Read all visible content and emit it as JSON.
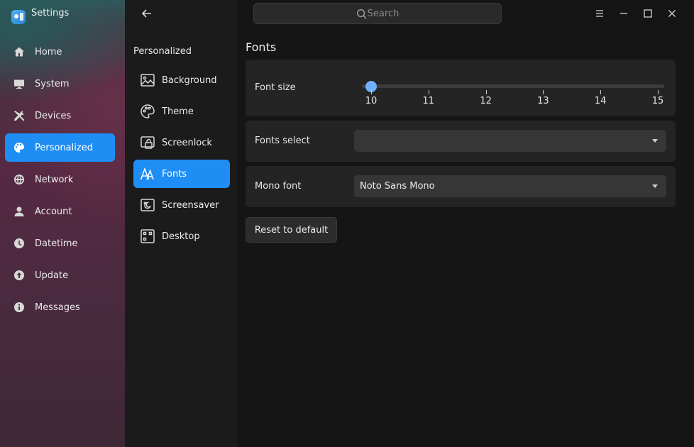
{
  "app": {
    "title": "Settings"
  },
  "sidebar": {
    "items": [
      {
        "label": "Home",
        "icon": "home-icon"
      },
      {
        "label": "System",
        "icon": "monitor-icon"
      },
      {
        "label": "Devices",
        "icon": "tools-icon"
      },
      {
        "label": "Personalized",
        "icon": "palette-icon",
        "active": true
      },
      {
        "label": "Network",
        "icon": "globe-icon"
      },
      {
        "label": "Account",
        "icon": "user-icon"
      },
      {
        "label": "Datetime",
        "icon": "clock-icon"
      },
      {
        "label": "Update",
        "icon": "update-icon"
      },
      {
        "label": "Messages",
        "icon": "info-icon"
      }
    ]
  },
  "middle": {
    "title": "Personalized",
    "items": [
      {
        "label": "Background",
        "icon": "image-icon"
      },
      {
        "label": "Theme",
        "icon": "theme-palette-icon"
      },
      {
        "label": "Screenlock",
        "icon": "screenlock-icon"
      },
      {
        "label": "Fonts",
        "icon": "fonts-icon",
        "active": true
      },
      {
        "label": "Screensaver",
        "icon": "screensaver-icon"
      },
      {
        "label": "Desktop",
        "icon": "desktop-icon"
      }
    ]
  },
  "header": {
    "search_placeholder": "Search"
  },
  "fonts": {
    "title": "Fonts",
    "font_size": {
      "label": "Font size",
      "ticks": [
        "10",
        "11",
        "12",
        "13",
        "14",
        "15"
      ],
      "value": 10
    },
    "fonts_select": {
      "label": "Fonts select",
      "value": ""
    },
    "mono_font": {
      "label": "Mono font",
      "value": "Noto Sans Mono"
    },
    "reset_label": "Reset to default"
  },
  "colors": {
    "accent": "#1f8ef4",
    "slider_handle": "#6fb0ff"
  }
}
